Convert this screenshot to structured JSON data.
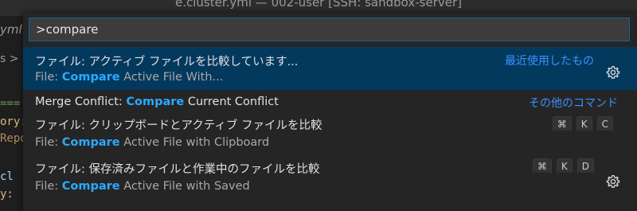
{
  "window": {
    "title": "e.cluster.yml — 002-user [SSH: sandbox-server]"
  },
  "editor": {
    "tab_fragment": "yml",
    "breadcrumb_fragment": "s >",
    "code_fragments": [
      "===",
      "ory:",
      "Repo",
      "  cl",
      "y:"
    ]
  },
  "palette": {
    "search_value": ">compare",
    "items": [
      {
        "label": "ファイル: アクティブ ファイルを比較しています...",
        "detail_prefix": "File: ",
        "detail_highlight": "Compare",
        "detail_suffix": " Active File With...",
        "group": "最近使用したもの",
        "has_gear": true,
        "selected": true
      },
      {
        "label_prefix": "Merge Conflict: ",
        "label_highlight": "Compare",
        "label_suffix": " Current Conflict",
        "group": "その他のコマンド"
      },
      {
        "label": "ファイル: クリップボードとアクティブ ファイルを比較",
        "detail_prefix": "File: ",
        "detail_highlight": "Compare",
        "detail_suffix": " Active File with Clipboard",
        "keys": [
          "⌘",
          "K",
          "C"
        ]
      },
      {
        "label": "ファイル: 保存済みファイルと作業中のファイルを比較",
        "detail_prefix": "File: ",
        "detail_highlight": "Compare",
        "detail_suffix": " Active File with Saved",
        "keys": [
          "⌘",
          "K",
          "D"
        ],
        "has_gear": true
      }
    ]
  },
  "colors": {
    "selection_bg": "#04395e",
    "highlight": "#2aaaff",
    "group_label": "#3794ff",
    "focus_border": "#0e639c"
  }
}
